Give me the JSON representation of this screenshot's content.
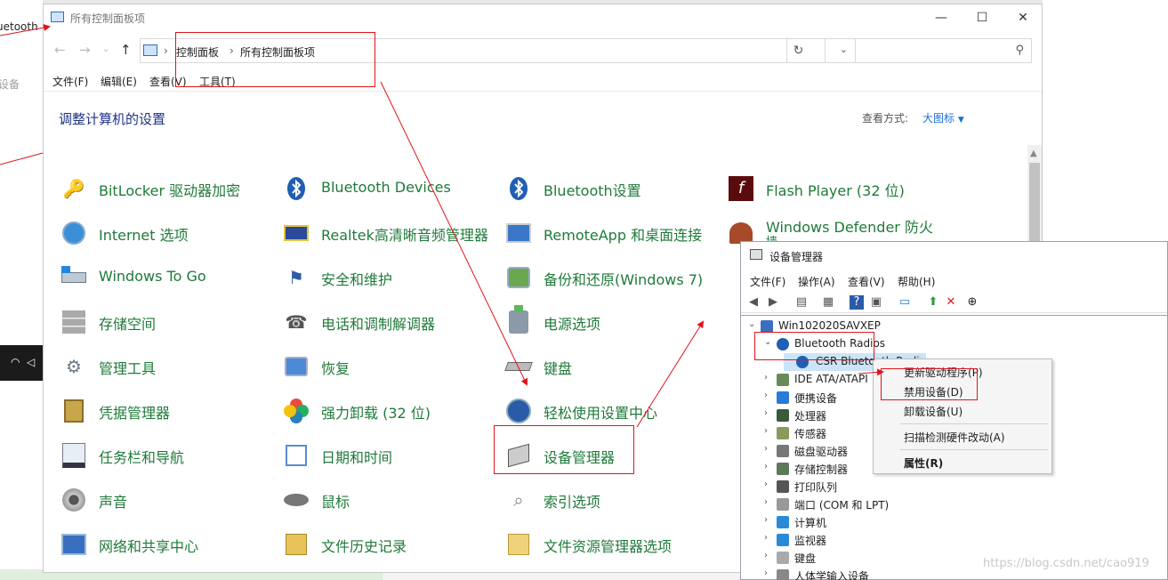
{
  "background": {
    "left_text_1": "uetooth",
    "left_text_2": "设备"
  },
  "control_panel": {
    "window_title": "所有控制面板项",
    "address": {
      "crumbs": [
        "控制面板",
        "所有控制面板项"
      ]
    },
    "menu": [
      "文件(F)",
      "编辑(E)",
      "查看(V)",
      "工具(T)"
    ],
    "heading": "调整计算机的设置",
    "view_by_label": "查看方式:",
    "view_by_value": "大图标",
    "items": [
      {
        "label": "BitLocker 驱动器加密",
        "icon": "bitlocker-icon"
      },
      {
        "label": "Bluetooth Devices",
        "icon": "bluetooth-icon"
      },
      {
        "label": "Bluetooth设置",
        "icon": "bluetooth-icon"
      },
      {
        "label": "Flash Player (32 位)",
        "icon": "flash-icon"
      },
      {
        "label": "Internet 选项",
        "icon": "internet-icon"
      },
      {
        "label": "Realtek高清晰音频管理器",
        "icon": "audio-manager-icon"
      },
      {
        "label": "RemoteApp 和桌面连接",
        "icon": "remoteapp-icon"
      },
      {
        "label": "Windows Defender 防火",
        "label2": "墙",
        "icon": "firewall-icon"
      },
      {
        "label": "Windows To Go",
        "icon": "windows-to-go-icon"
      },
      {
        "label": "安全和维护",
        "icon": "flag-icon"
      },
      {
        "label": "备份和还原(Windows 7)",
        "icon": "backup-icon"
      },
      {
        "label": "存储空间",
        "icon": "storage-icon"
      },
      {
        "label": "电话和调制解调器",
        "icon": "phone-icon"
      },
      {
        "label": "电源选项",
        "icon": "power-icon"
      },
      {
        "label": "管理工具",
        "icon": "admin-tools-icon"
      },
      {
        "label": "恢复",
        "icon": "recovery-icon"
      },
      {
        "label": "键盘",
        "icon": "keyboard-icon"
      },
      {
        "label": "凭据管理器",
        "icon": "credential-icon"
      },
      {
        "label": "强力卸载 (32 位)",
        "icon": "uninstall-icon"
      },
      {
        "label": "轻松使用设置中心",
        "icon": "ease-of-access-icon"
      },
      {
        "label": "任务栏和导航",
        "icon": "taskbar-icon"
      },
      {
        "label": "日期和时间",
        "icon": "calendar-icon"
      },
      {
        "label": "设备管理器",
        "icon": "device-manager-icon"
      },
      {
        "label": "声音",
        "icon": "speaker-icon"
      },
      {
        "label": "鼠标",
        "icon": "mouse-icon"
      },
      {
        "label": "索引选项",
        "icon": "index-icon"
      },
      {
        "label": "网络和共享中心",
        "icon": "network-icon"
      },
      {
        "label": "文件历史记录",
        "icon": "file-history-icon"
      },
      {
        "label": "文件资源管理器选项",
        "icon": "folder-options-icon"
      }
    ]
  },
  "device_manager": {
    "title": "设备管理器",
    "menu": [
      "文件(F)",
      "操作(A)",
      "查看(V)",
      "帮助(H)"
    ],
    "root": "Win102020SAVXEP",
    "expanded_category": "Bluetooth Radios",
    "selected_device": "CSR Bluetooth Radio",
    "categories": [
      "IDE ATA/ATAPI",
      "便携设备",
      "处理器",
      "传感器",
      "磁盘驱动器",
      "存储控制器",
      "打印队列",
      "端口 (COM 和 LPT)",
      "计算机",
      "监视器",
      "键盘",
      "人体学输入设备"
    ]
  },
  "context_menu": {
    "items": [
      "更新驱动程序(P)",
      "禁用设备(D)",
      "卸载设备(U)",
      "扫描检测硬件改动(A)",
      "属性(R)"
    ]
  },
  "watermark": "https://blog.csdn.net/cao919",
  "colors": {
    "link_green": "#1f7a3a",
    "heading_blue": "#1e3287",
    "annotation_red": "#e0141a"
  }
}
